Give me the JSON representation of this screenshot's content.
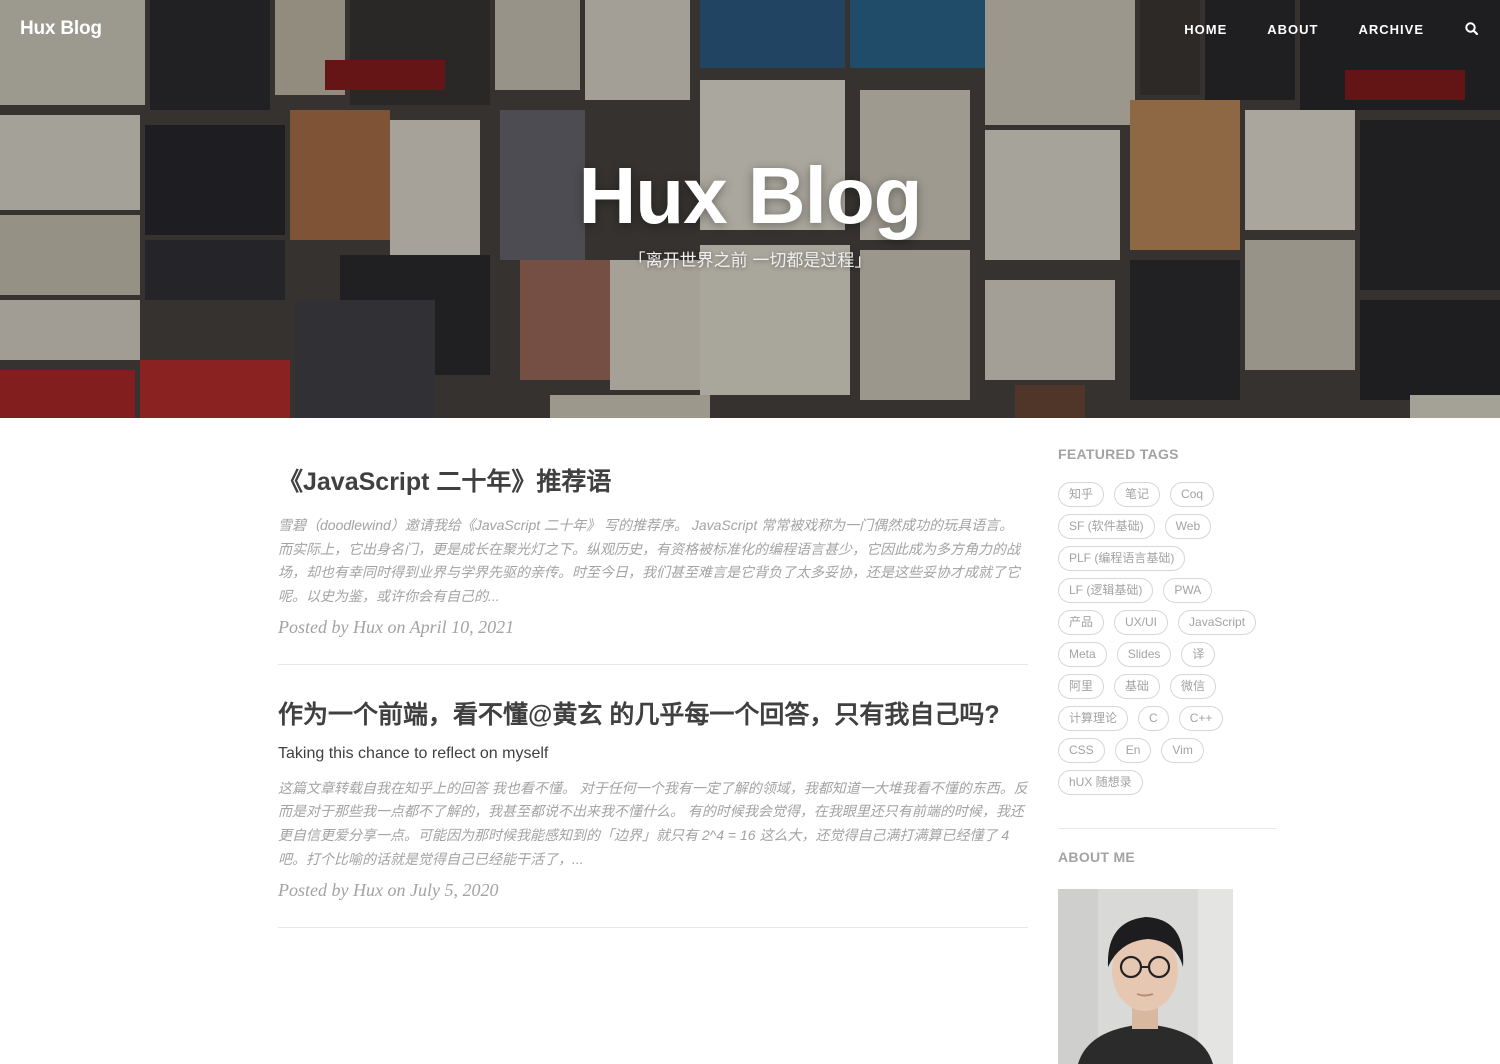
{
  "colors": {
    "text": "#404040",
    "muted": "#a3a3a3",
    "white": "#ffffff",
    "divider": "#e8e8e8"
  },
  "header": {
    "brand": "Hux Blog",
    "nav": [
      {
        "label": "HOME"
      },
      {
        "label": "ABOUT"
      },
      {
        "label": "ARCHIVE"
      }
    ],
    "search_icon": "search-icon"
  },
  "hero": {
    "title": "Hux Blog",
    "subtitle": "「离开世界之前 一切都是过程」"
  },
  "posts": [
    {
      "title": "《JavaScript 二十年》推荐语",
      "subtitle": "",
      "excerpt": "雪碧（doodlewind）邀请我给《JavaScript 二十年》 写的推荐序。 JavaScript 常常被戏称为一门偶然成功的玩具语言。 而实际上，它出身名门，更是成长在聚光灯之下。纵观历史，有资格被标准化的编程语言甚少，它因此成为多方角力的战场，却也有幸同时得到业界与学界先驱的亲传。时至今日，我们甚至难言是它背负了太多妥协，还是这些妥协才成就了它呢。以史为鉴，或许你会有自己的...",
      "meta": "Posted by Hux on April 10, 2021"
    },
    {
      "title": "作为一个前端，看不懂@黄玄 的几乎每一个回答，只有我自己吗?",
      "subtitle": "Taking this chance to reflect on myself",
      "excerpt": "这篇文章转载自我在知乎上的回答 我也看不懂。 对于任何一个我有一定了解的领域，我都知道一大堆我看不懂的东西。反而是对于那些我一点都不了解的，我甚至都说不出来我不懂什么。 有的时候我会觉得，在我眼里还只有前端的时候，我还更自信更爱分享一点。可能因为那时候我能感知到的「边界」就只有 2^4 = 16 这么大，还觉得自己满打满算已经懂了 4 吧。打个比喻的话就是觉得自己已经能干活了，...",
      "meta": "Posted by Hux on July 5, 2020"
    }
  ],
  "sidebar": {
    "featured_heading": "FEATURED TAGS",
    "tags": [
      "知乎",
      "笔记",
      "Coq",
      "SF (软件基础)",
      "Web",
      "PLF (编程语言基础)",
      "LF (逻辑基础)",
      "PWA",
      "产品",
      "UX/UI",
      "JavaScript",
      "Meta",
      "Slides",
      "译",
      "阿里",
      "基础",
      "微信",
      "计算理论",
      "C",
      "C++",
      "CSS",
      "En",
      "Vim",
      "hUX 随想录"
    ],
    "about_heading": "ABOUT ME"
  }
}
